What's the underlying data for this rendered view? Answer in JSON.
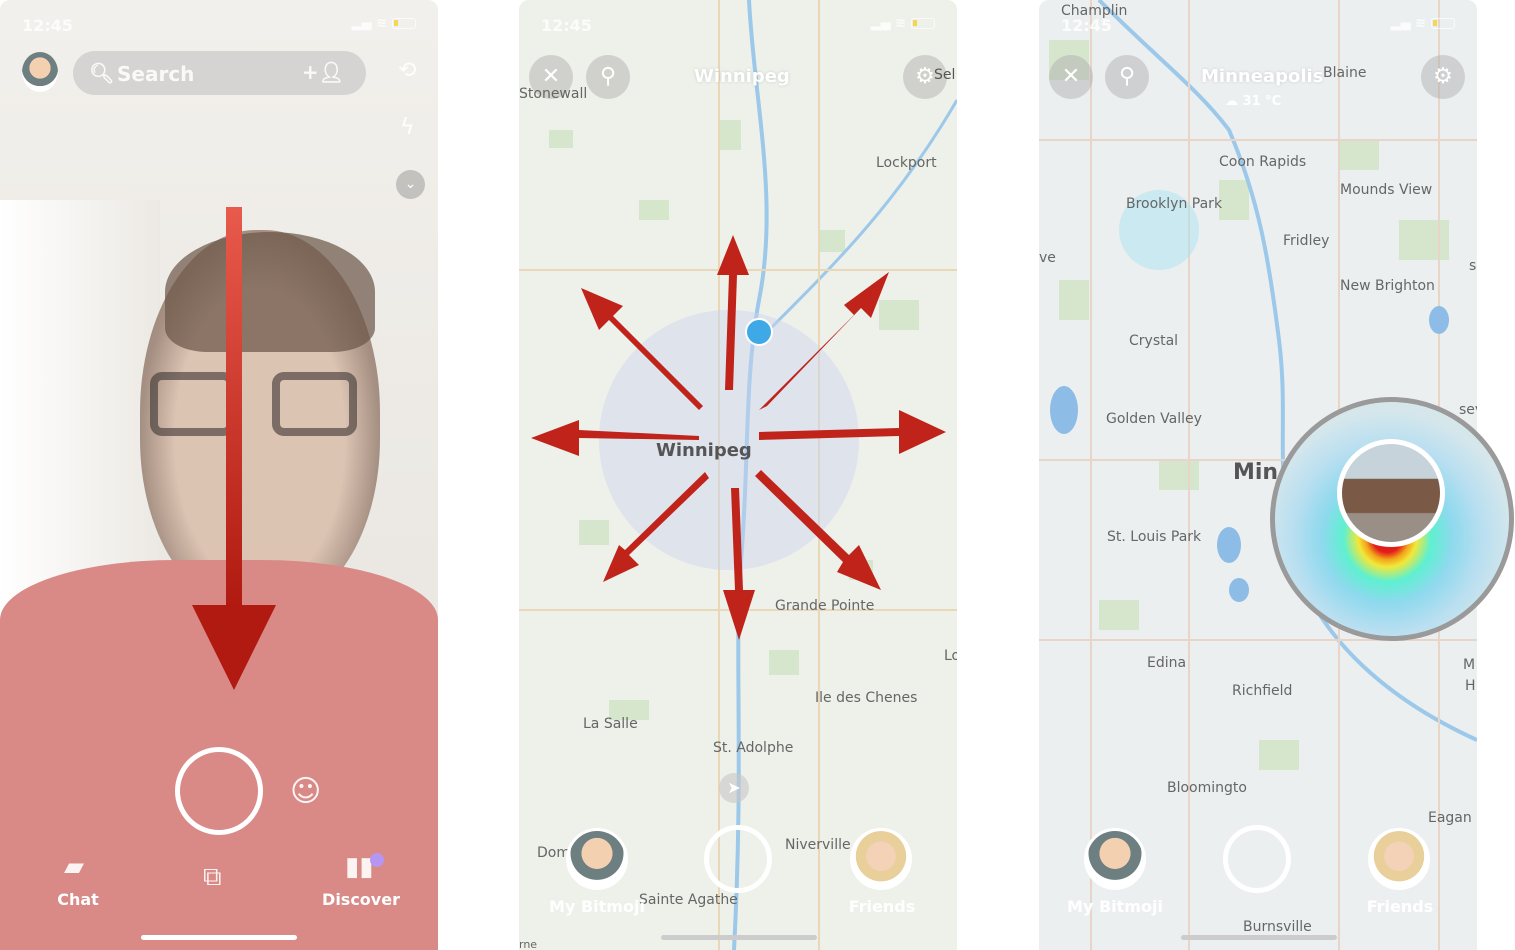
{
  "panel1": {
    "status": {
      "time": "12:45",
      "location_icon": "location-arrow-icon"
    },
    "search": {
      "placeholder": "Search",
      "icon": "search-icon",
      "add_friend_icon": "add-friend-icon"
    },
    "side_icons": [
      "flip-camera-icon",
      "flash-off-icon",
      "chevron-down-icon"
    ],
    "nav": {
      "chat": "Chat",
      "discover": "Discover"
    },
    "gesture": "swipe-down",
    "arrow_color": "#c0231a"
  },
  "panel2": {
    "status": {
      "time": "12:45"
    },
    "title": "Winnipeg",
    "settings_label_partial": "Sel",
    "map_labels": {
      "stonewall": "Stonewall",
      "lockport": "Lockport",
      "winnipeg": "Winnipeg",
      "grande_pointe": "Grande Pointe",
      "lo": "Lo",
      "ile_des_chenes": "Ile des Chenes",
      "la_salle": "La Salle",
      "st_adolphe": "St. Adolphe",
      "dom": "Dom",
      "niverville": "Niverville",
      "sainte_agathe": "Sainte Agathe",
      "rne": "rne"
    },
    "bottom": {
      "my_bitmoji": "My Bitmoji",
      "friends": "Friends"
    },
    "gesture": "pinch-zoom-arrows",
    "arrow_color": "#c0231a"
  },
  "panel3": {
    "status": {
      "time": "12:45",
      "top_label": "Champlin"
    },
    "title": "Minneapolis",
    "weather": "31 °C",
    "map_labels": {
      "blaine": "Blaine",
      "coon_rapids": "Coon Rapids",
      "brooklyn_park": "Brooklyn Park",
      "mounds_view": "Mounds View",
      "fridley": "Fridley",
      "new_brighton": "New Brighton",
      "crystal": "Crystal",
      "golden_valley": "Golden Valley",
      "min": "Min",
      "st_louis_park": "St. Louis Park",
      "edina": "Edina",
      "richfield": "Richfield",
      "bloomington": "Bloomingto",
      "eagan": "Eagan",
      "burnsville": "Burnsville",
      "ve": "ve",
      "sev": "sev",
      "s": "s",
      "m": "M",
      "h": "H"
    },
    "bottom": {
      "my_bitmoji": "My Bitmoji",
      "friends": "Friends"
    },
    "highlight": "snap-heatmap-story-thumbnail"
  }
}
